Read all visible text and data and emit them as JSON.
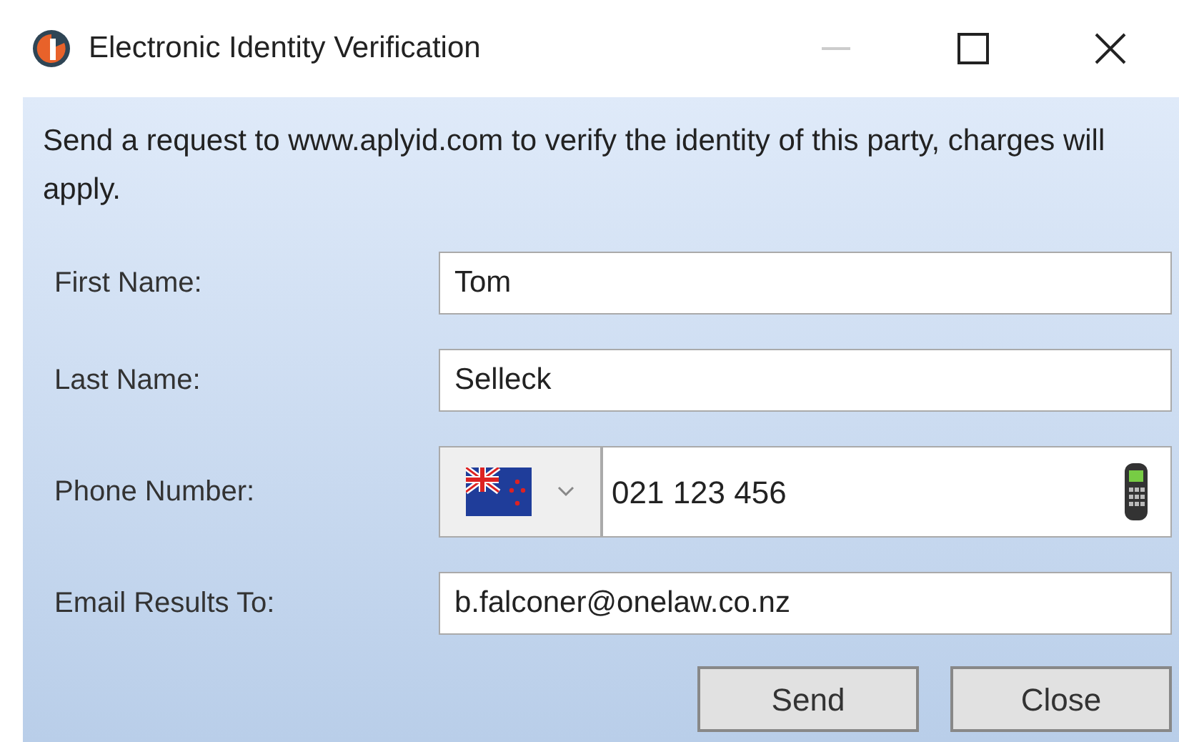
{
  "window": {
    "title": "Electronic Identity Verification"
  },
  "message": "Send a request to www.aplyid.com to verify the identity of this party, charges will apply.",
  "fields": [
    {
      "kind": "text",
      "label": "First Name:",
      "value": "Tom"
    },
    {
      "kind": "text",
      "label": "Last Name:",
      "value": "Selleck"
    },
    {
      "kind": "phone",
      "label": "Phone Number:",
      "value": "021 123 456"
    },
    {
      "kind": "text",
      "label": "Email Results To:",
      "value": "b.falconer@onelaw.co.nz"
    }
  ],
  "buttons": [
    "Send",
    "Close"
  ]
}
